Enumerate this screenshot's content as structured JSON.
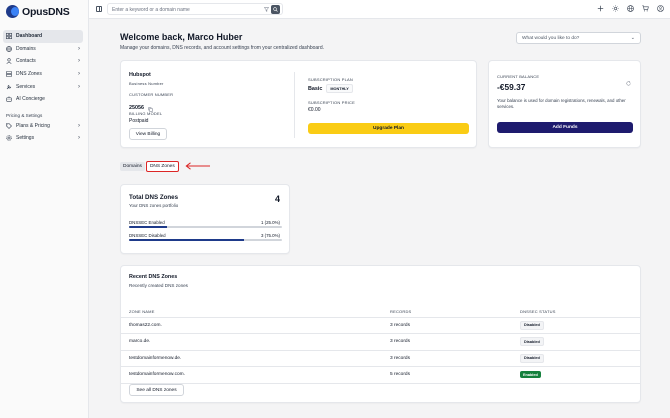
{
  "app": {
    "name": "OpusDNS"
  },
  "sidebar": {
    "items": [
      {
        "label": "Dashboard",
        "icon": "dashboard-icon",
        "active": true
      },
      {
        "label": "Domains",
        "icon": "globe-icon"
      },
      {
        "label": "Contacts",
        "icon": "user-icon"
      },
      {
        "label": "DNS Zones",
        "icon": "server-icon"
      },
      {
        "label": "Services",
        "icon": "wrench-icon"
      },
      {
        "label": "AI Concierge",
        "icon": "bot-icon"
      }
    ],
    "section_label": "Pricing & Settings",
    "section_items": [
      {
        "label": "Plans & Pricing",
        "icon": "tag-icon"
      },
      {
        "label": "Settings",
        "icon": "gear-icon"
      }
    ]
  },
  "topbar": {
    "search_placeholder": "Enter a keyword or a domain name"
  },
  "header": {
    "welcome": "Welcome back, Marco Huber",
    "subtitle": "Manage your domains, DNS records, and account settings from your centralized dashboard.",
    "ask_placeholder": "What would you like to do?"
  },
  "account": {
    "business_name": "Hubspot",
    "business_name_label": "Business Number",
    "customer_number_label": "CUSTOMER NUMBER",
    "customer_number": "25056",
    "billing_model_label": "BILLING MODEL",
    "billing_model": "Postpaid",
    "view_billing": "View Billing",
    "subscription_plan_label": "SUBSCRIPTION PLAN",
    "plan": "Basic",
    "plan_period": "MONTHLY",
    "subscription_price_label": "SUBSCRIPTION PRICE",
    "price": "€0.00",
    "upgrade": "Upgrade Plan"
  },
  "balance": {
    "label": "CURRENT BALANCE",
    "amount": "-€59.37",
    "description": "Your balance is used for domain registrations, renewals, and other services.",
    "add_funds": "Add Funds"
  },
  "tabs": [
    {
      "label": "Domains"
    },
    {
      "label": "DNS Zones"
    }
  ],
  "dns_summary": {
    "title": "Total DNS Zones",
    "subtitle": "Your DNS zones portfolio",
    "total": "4",
    "enabled_label": "DNSSEC Enabled",
    "enabled_value": "1 (25.0%)",
    "enabled_fraction": 0.25,
    "disabled_label": "DNSSEC Disabled",
    "disabled_value": "3 (75.0%)",
    "disabled_fraction": 0.75
  },
  "recent": {
    "title": "Recent DNS Zones",
    "subtitle": "Recently created DNS zones",
    "columns": [
      "ZONE NAME",
      "RECORDS",
      "DNSSEC STATUS"
    ],
    "rows": [
      {
        "zone": "thomas22.com.",
        "records": "3 records",
        "status": "Disabled"
      },
      {
        "zone": "marco.de.",
        "records": "3 records",
        "status": "Disabled"
      },
      {
        "zone": "testdomainformenow.de.",
        "records": "3 records",
        "status": "Disabled"
      },
      {
        "zone": "testdomainformenow.com.",
        "records": "5 records",
        "status": "Enabled"
      }
    ],
    "see_all": "See all DNS zones"
  },
  "colors": {
    "primary": "#1e3a8a",
    "upgrade": "#facc15",
    "enabled": "#15803d",
    "annotation": "#dc2626"
  }
}
